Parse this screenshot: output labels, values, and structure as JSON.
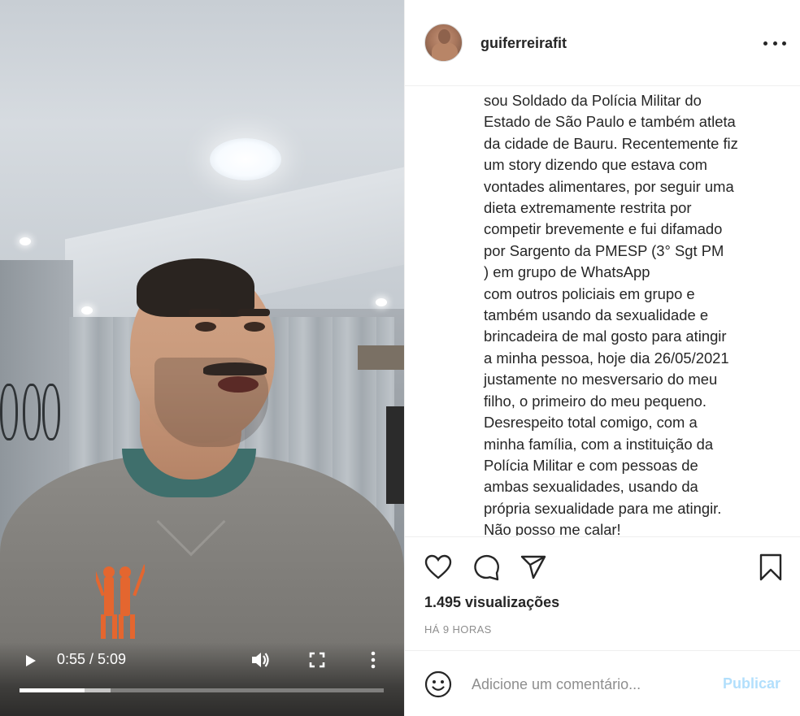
{
  "video": {
    "time_display": "0:55 / 5:09",
    "current_time": "0:55",
    "duration": "5:09",
    "played_fraction": 0.178,
    "buffered_fraction": 0.25,
    "icons": {
      "play": "play-icon",
      "volume": "volume-icon",
      "fullscreen": "fullscreen-icon",
      "more": "more-vertical-icon"
    }
  },
  "post": {
    "username": "guiferreirafit",
    "caption": "sou Soldado da Polícia Militar do\nEstado de São Paulo e também atleta\nda cidade de Bauru. Recentemente fiz\num story dizendo que estava com\nvontades alimentares, por seguir uma\ndieta extremamente restrita por\ncompetir brevemente e fui difamado\npor Sargento da PMESP (3° Sgt PM\n) em grupo de WhatsApp\ncom outros policiais em grupo e\ntambém usando da sexualidade e\nbrincadeira de mal gosto para atingir\na minha pessoa, hoje dia 26/05/2021\njustamente no mesversario do meu\nfilho, o primeiro do meu pequeno.\nDesrespeito total comigo, com a\nminha família, com a instituição da\nPolícia Militar e com pessoas de\nambas sexualidades, usando da\nprópria sexualidade para me atingir.\nNão posso me calar!",
    "views": "1.495 visualizações",
    "time_ago": "HÁ 9 HORAS",
    "icons": {
      "more": "more-horizontal-icon",
      "like": "heart-icon",
      "comment": "comment-icon",
      "share": "share-icon",
      "save": "bookmark-icon",
      "emoji": "emoji-icon"
    }
  },
  "comment_box": {
    "placeholder": "Adicione um comentário...",
    "value": "",
    "publish_label": "Publicar"
  },
  "colors": {
    "publish_disabled": "#b2dffc",
    "text_primary": "#262626",
    "text_secondary": "#8e8e8e",
    "divider": "#efefef"
  }
}
